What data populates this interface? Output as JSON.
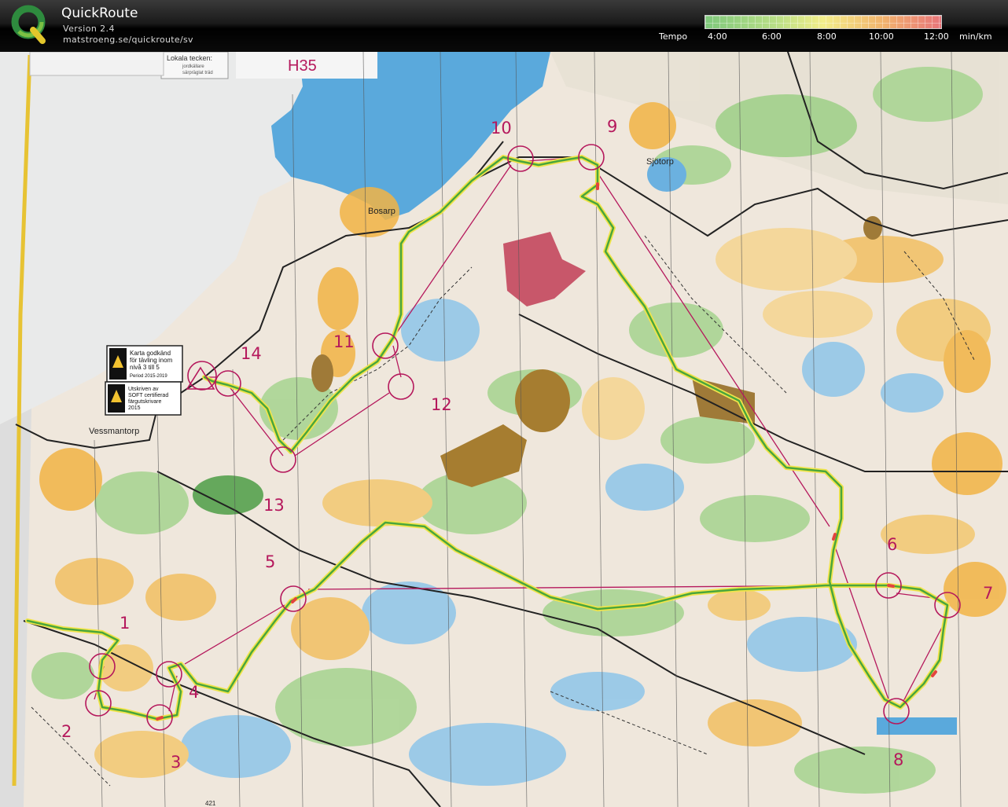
{
  "app": {
    "title": "QuickRoute",
    "version": "Version 2.4",
    "url": "matstroeng.se/quickroute/sv"
  },
  "tempo": {
    "label": "Tempo",
    "ticks": [
      "4:00",
      "6:00",
      "8:00",
      "10:00",
      "12:00"
    ],
    "unit": "min/km",
    "colors": {
      "slow": "#e8757a",
      "mid": "#f3ee8a",
      "fast": "#7fc87c"
    }
  },
  "map": {
    "course": "H35",
    "places": {
      "bosarp": "Bosarp",
      "sjotorp": "Sjötorp",
      "vessmantorp": "Vessmantorp"
    },
    "legend_box": {
      "title": "Lokala tecken:",
      "line1": "jordkällare",
      "line2": "särpräglat träd"
    },
    "badge1": [
      "Karta godkänd",
      "för tävling inom",
      "nivå 3 till 5",
      "Period 2015-2019"
    ],
    "badge2": [
      "Utskriven av",
      "SOFT certifierad",
      "färgutskrivare",
      "2015"
    ],
    "bottom_number": "421",
    "controls": [
      "1",
      "2",
      "3",
      "4",
      "5",
      "6",
      "7",
      "8",
      "9",
      "10",
      "11",
      "12",
      "13",
      "14"
    ]
  }
}
